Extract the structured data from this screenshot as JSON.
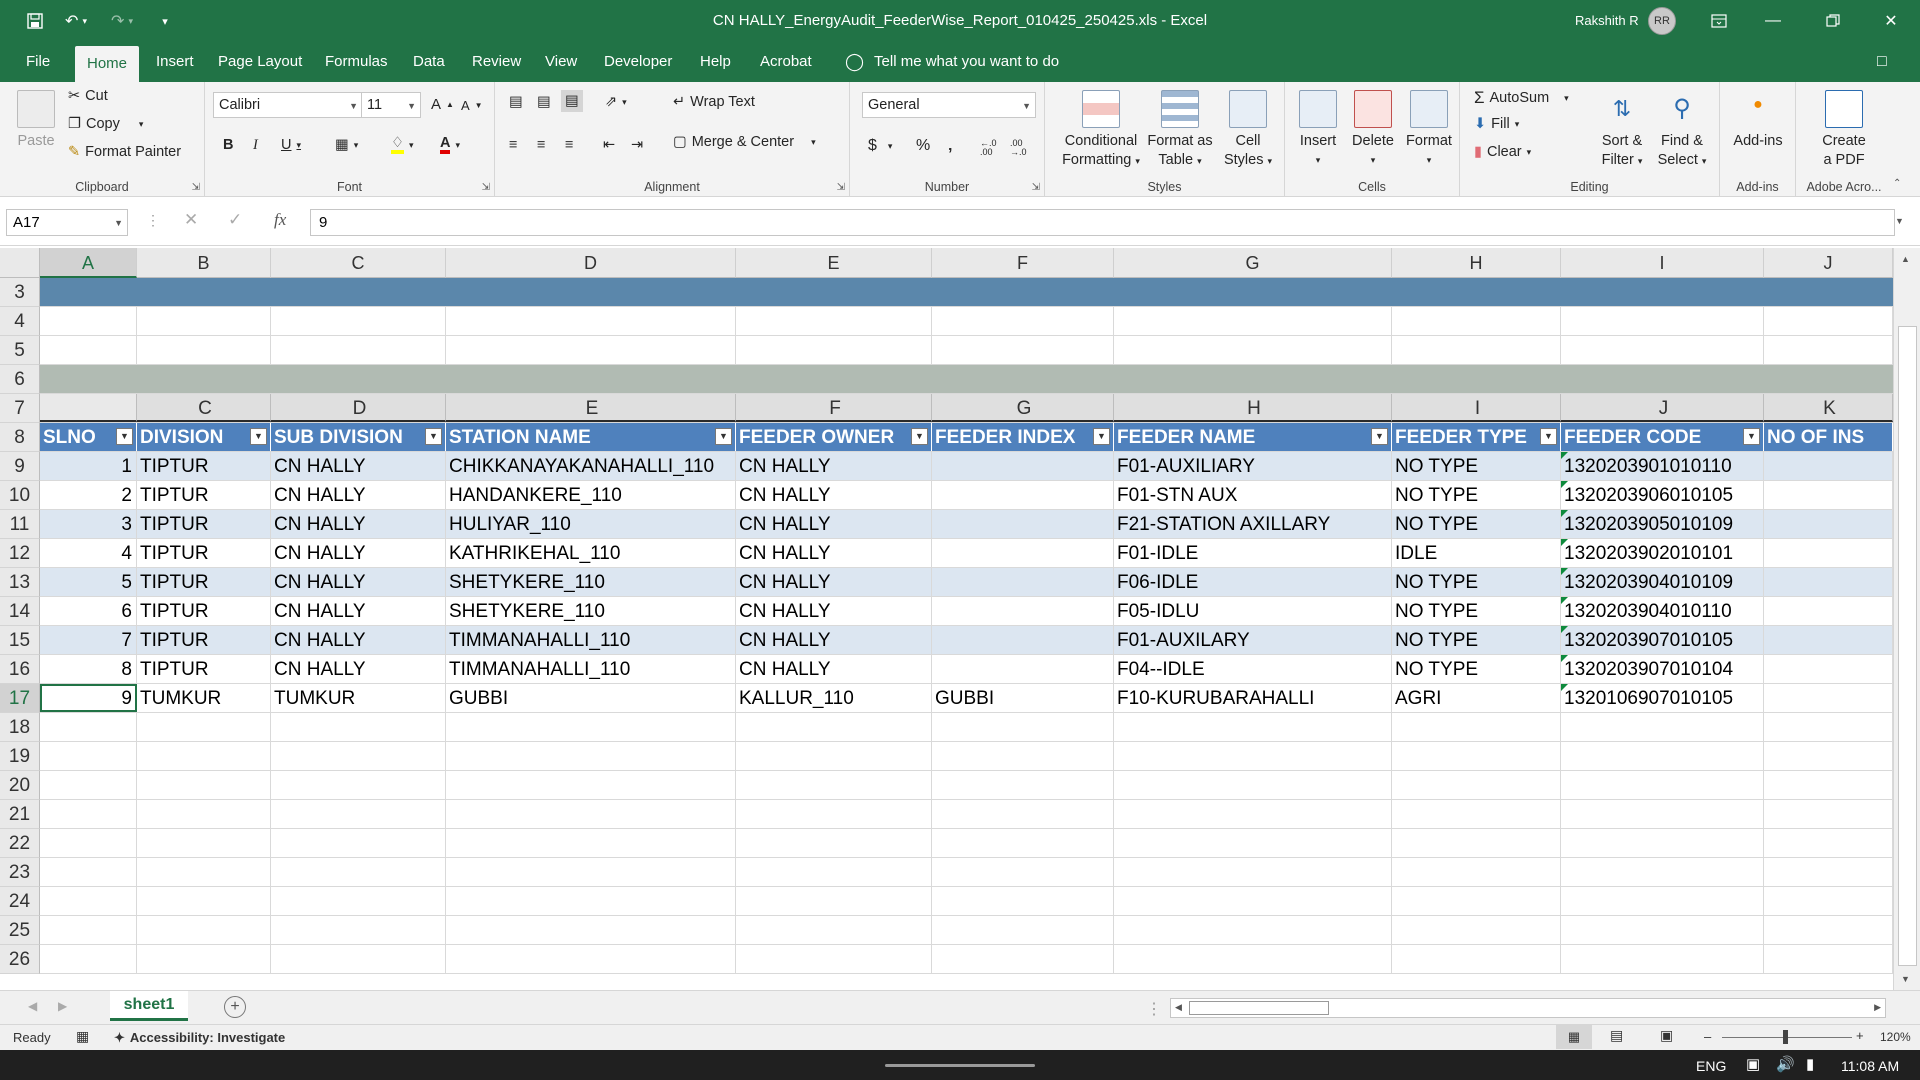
{
  "window": {
    "title": "CN HALLY_EnergyAudit_FeederWise_Report_010425_250425.xls  -  Excel",
    "user": "Rakshith R",
    "initials": "RR"
  },
  "tabs": [
    "File",
    "Home",
    "Insert",
    "Page Layout",
    "Formulas",
    "Data",
    "Review",
    "View",
    "Developer",
    "Help",
    "Acrobat"
  ],
  "tell_me": "Tell me what you want to do",
  "ribbon": {
    "clipboard": {
      "paste": "Paste",
      "cut": "Cut",
      "copy": "Copy",
      "format_painter": "Format Painter",
      "label": "Clipboard"
    },
    "font": {
      "name": "Calibri",
      "size": "11",
      "label": "Font",
      "bold": "B",
      "italic": "I",
      "underline": "U",
      "grow": "A",
      "shrink": "A"
    },
    "alignment": {
      "wrap": "Wrap Text",
      "merge": "Merge & Center",
      "label": "Alignment"
    },
    "number": {
      "format": "General",
      "currency": "$",
      "percent": "%",
      "comma": "‚",
      "inc_dec": "←.0 .00",
      "dec_dec": ".00 →.0",
      "label": "Number"
    },
    "styles": {
      "cond1": "Conditional",
      "cond2": "Formatting",
      "fmt1": "Format as",
      "fmt2": "Table",
      "cell1": "Cell",
      "cell2": "Styles",
      "label": "Styles"
    },
    "cells": {
      "insert": "Insert",
      "delete": "Delete",
      "format": "Format",
      "label": "Cells"
    },
    "editing": {
      "autosum": "AutoSum",
      "fill": "Fill",
      "clear": "Clear",
      "sort1": "Sort &",
      "sort2": "Filter",
      "find1": "Find &",
      "find2": "Select",
      "label": "Editing"
    },
    "addins": {
      "btn": "Add-ins",
      "label": "Add-ins"
    },
    "acrobat": {
      "btn1": "Create",
      "btn2": "a PDF",
      "label": "Adobe Acro..."
    }
  },
  "formula_bar": {
    "name_box": "A17",
    "fx": "fx",
    "value": "9"
  },
  "columns": [
    "A",
    "B",
    "C",
    "D",
    "E",
    "F",
    "G",
    "H",
    "I",
    "J"
  ],
  "table_header_letters": [
    "",
    "C",
    "D",
    "E",
    "F",
    "G",
    "H",
    "I",
    "J",
    "K"
  ],
  "headers": [
    "SLNO",
    "DIVISION",
    "SUB DIVISION",
    "STATION NAME",
    "FEEDER OWNER",
    "FEEDER INDEX",
    "FEEDER NAME",
    "FEEDER TYPE",
    "FEEDER CODE",
    "NO OF INS"
  ],
  "row_numbers": [
    "3",
    "4",
    "5",
    "6",
    "7",
    "8",
    "9",
    "10",
    "11",
    "12",
    "13",
    "14",
    "15",
    "16",
    "17",
    "18",
    "19",
    "20",
    "21",
    "22",
    "23",
    "24",
    "25",
    "26"
  ],
  "rows": [
    [
      "1",
      "TIPTUR",
      "CN HALLY",
      "CHIKKANAYAKANAHALLI_110",
      "CN HALLY",
      "",
      "F01-AUXILIARY",
      "NO TYPE",
      "1320203901010110",
      ""
    ],
    [
      "2",
      "TIPTUR",
      "CN HALLY",
      "HANDANKERE_110",
      "CN HALLY",
      "",
      "F01-STN AUX",
      "NO TYPE",
      "1320203906010105",
      ""
    ],
    [
      "3",
      "TIPTUR",
      "CN HALLY",
      "HULIYAR_110",
      "CN HALLY",
      "",
      "F21-STATION AXILLARY",
      "NO TYPE",
      "1320203905010109",
      ""
    ],
    [
      "4",
      "TIPTUR",
      "CN HALLY",
      "KATHRIKEHAL_110",
      "CN HALLY",
      "",
      "F01-IDLE",
      "IDLE",
      "1320203902010101",
      ""
    ],
    [
      "5",
      "TIPTUR",
      "CN HALLY",
      "SHETYKERE_110",
      "CN HALLY",
      "",
      "F06-IDLE",
      "NO TYPE",
      "1320203904010109",
      ""
    ],
    [
      "6",
      "TIPTUR",
      "CN HALLY",
      "SHETYKERE_110",
      "CN HALLY",
      "",
      "F05-IDLU",
      "NO TYPE",
      "1320203904010110",
      ""
    ],
    [
      "7",
      "TIPTUR",
      "CN HALLY",
      "TIMMANAHALLI_110",
      "CN HALLY",
      "",
      "F01-AUXILARY",
      "NO TYPE",
      "1320203907010105",
      ""
    ],
    [
      "8",
      "TIPTUR",
      "CN HALLY",
      "TIMMANAHALLI_110",
      "CN HALLY",
      "",
      "F04--IDLE",
      "NO TYPE",
      "1320203907010104",
      ""
    ],
    [
      "9",
      "TUMKUR",
      "TUMKUR",
      "GUBBI",
      "KALLUR_110",
      "GUBBI",
      "F10-KURUBARAHALLI",
      "AGRI",
      "1320106907010105",
      ""
    ]
  ],
  "sheet": {
    "name": "sheet1"
  },
  "status": {
    "ready": "Ready",
    "accessibility": "Accessibility: Investigate",
    "zoom": "120%"
  },
  "taskbar": {
    "lang": "ENG",
    "time": "11:08 AM"
  },
  "colors": {
    "excel_green": "#217346",
    "band_blue": "#5b87ab",
    "band_gray": "#b1bbb3",
    "header_blue": "#4f81bd",
    "stripe": "#dce6f1"
  }
}
